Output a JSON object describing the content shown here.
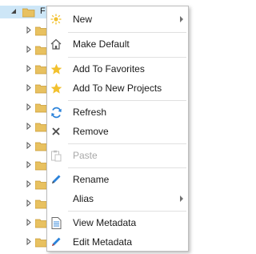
{
  "tree": {
    "top_label": "F"
  },
  "menu": {
    "items": [
      {
        "label": "New",
        "icon": "sun-new-icon",
        "submenu": true
      },
      {
        "label": "Make Default",
        "icon": "home-icon"
      },
      {
        "label": "Add To Favorites",
        "icon": "star-icon"
      },
      {
        "label": "Add To New Projects",
        "icon": "star-icon"
      },
      {
        "label": "Refresh",
        "icon": "refresh-icon"
      },
      {
        "label": "Remove",
        "icon": "remove-x-icon"
      },
      {
        "label": "Paste",
        "icon": "paste-icon",
        "disabled": true
      },
      {
        "label": "Rename",
        "icon": "pencil-icon"
      },
      {
        "label": "Alias",
        "icon": "",
        "submenu": true
      },
      {
        "label": "View Metadata",
        "icon": "document-icon"
      },
      {
        "label": "Edit Metadata",
        "icon": "edit-pencil-icon"
      }
    ]
  },
  "colors": {
    "folder": "#e8c160",
    "star": "#f2c12e",
    "refresh": "#2b82d9",
    "selection": "#cde6f7"
  }
}
